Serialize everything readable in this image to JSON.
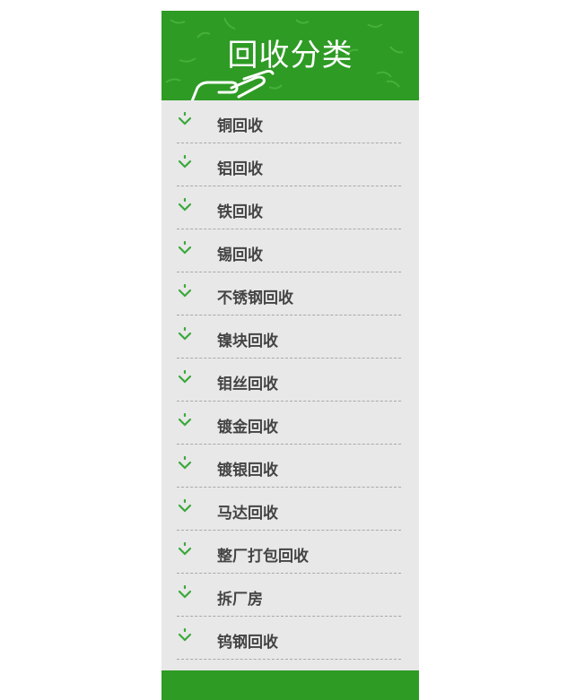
{
  "header": {
    "title": "回收分类"
  },
  "categories": [
    {
      "label": "铜回收"
    },
    {
      "label": "铝回收"
    },
    {
      "label": "铁回收"
    },
    {
      "label": "锡回收"
    },
    {
      "label": "不锈钢回收"
    },
    {
      "label": "镍块回收"
    },
    {
      "label": "钼丝回收"
    },
    {
      "label": "镀金回收"
    },
    {
      "label": "镀银回收"
    },
    {
      "label": "马达回收"
    },
    {
      "label": "整厂打包回收"
    },
    {
      "label": "拆厂房"
    },
    {
      "label": "钨钢回收"
    }
  ],
  "colors": {
    "brand_green": "#2e9b24",
    "arrow_green": "#3aa83a",
    "panel_bg": "#e8e8e8",
    "text": "#444444"
  },
  "icons": {
    "list_marker": "chevron-down-icon",
    "header_graphic": "hand-icon"
  }
}
